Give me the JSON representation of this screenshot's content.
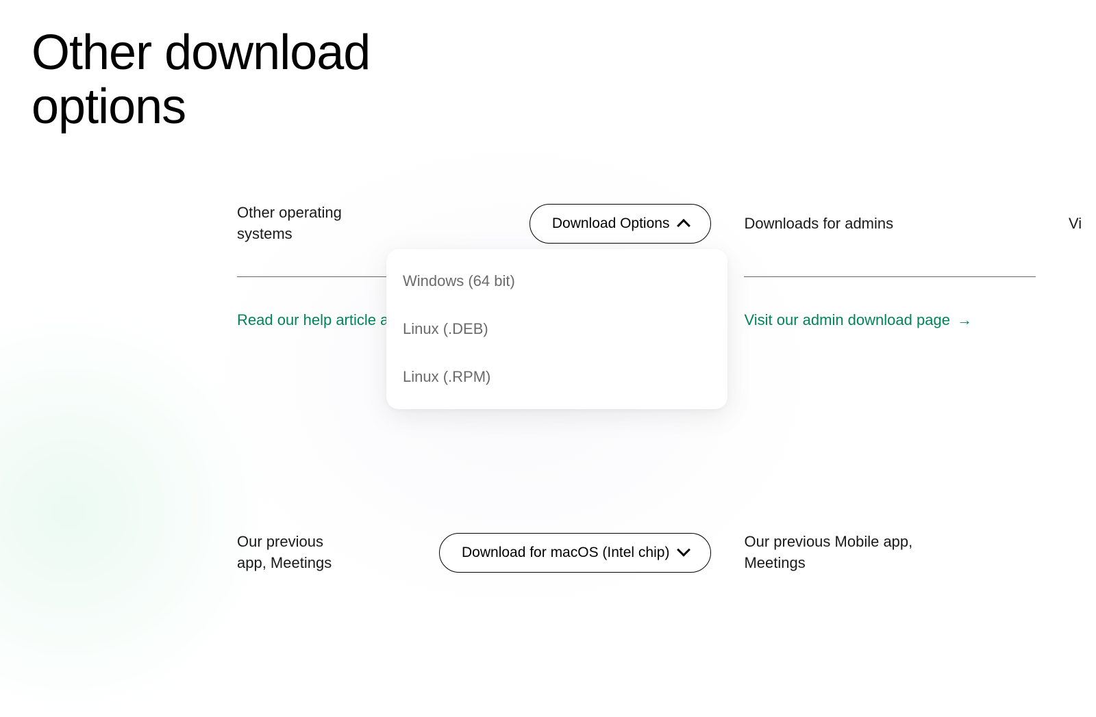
{
  "title": "Other download options",
  "columns": {
    "os": {
      "heading": "Other operating systems",
      "dropdown_label": "Download Options",
      "dropdown_items": [
        "Windows (64 bit)",
        "Linux (.DEB)",
        "Linux (.RPM)"
      ],
      "help_link_prefix": "Read our help article ab",
      "previous_heading": "Our previous app, Meetings",
      "previous_button": "Download for macOS (Intel chip)"
    },
    "admins": {
      "heading": "Downloads for admins",
      "link_text": "Visit our admin download page",
      "link_arrow": "→",
      "previous_heading": "Our previous Mobile app, Meetings"
    },
    "vdi": {
      "heading_partial": "Vi"
    }
  }
}
